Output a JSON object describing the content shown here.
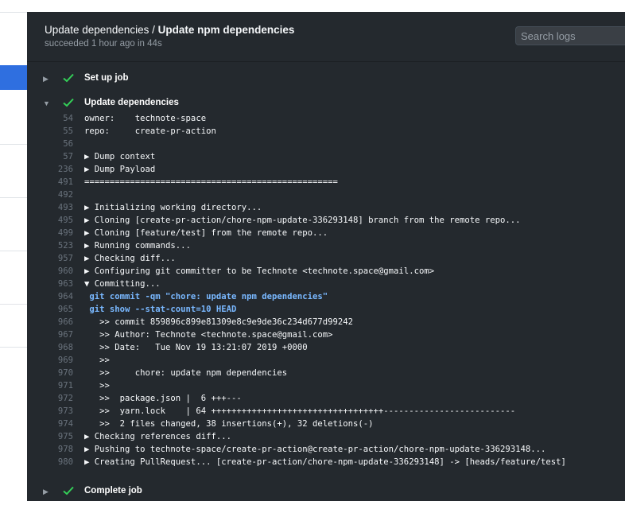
{
  "header": {
    "title_prefix": "Update dependencies / ",
    "title_bold": "Update npm dependencies",
    "subtitle": "succeeded 1 hour ago in 44s"
  },
  "search": {
    "placeholder": "Search logs"
  },
  "steps": {
    "setup": {
      "label": "Set up job",
      "status": "success"
    },
    "update": {
      "label": "Update dependencies",
      "status": "success",
      "expanded": true
    },
    "complete": {
      "label": "Complete job",
      "status": "success"
    }
  },
  "colors": {
    "success": "#34d058",
    "command": "#79b8ff",
    "panel_bg": "#24292e",
    "selected_nav": "#2f6fe0"
  },
  "log_lines": [
    {
      "num": "54",
      "text": "owner:    technote-space"
    },
    {
      "num": "55",
      "text": "repo:     create-pr-action"
    },
    {
      "num": "56",
      "text": ""
    },
    {
      "num": "57",
      "text": "▶ Dump context"
    },
    {
      "num": "236",
      "text": "▶ Dump Payload"
    },
    {
      "num": "491",
      "text": "=================================================="
    },
    {
      "num": "492",
      "text": ""
    },
    {
      "num": "493",
      "text": "▶ Initializing working directory..."
    },
    {
      "num": "495",
      "text": "▶ Cloning [create-pr-action/chore-npm-update-336293148] branch from the remote repo..."
    },
    {
      "num": "499",
      "text": "▶ Cloning [feature/test] from the remote repo..."
    },
    {
      "num": "523",
      "text": "▶ Running commands..."
    },
    {
      "num": "957",
      "text": "▶ Checking diff..."
    },
    {
      "num": "960",
      "text": "▶ Configuring git committer to be Technote <technote.space@gmail.com>"
    },
    {
      "num": "963",
      "text": "▼ Committing..."
    },
    {
      "num": "964",
      "text": " git commit -qm \"chore: update npm dependencies\"",
      "cmd": true
    },
    {
      "num": "965",
      "text": " git show --stat-count=10 HEAD",
      "cmd": true
    },
    {
      "num": "966",
      "text": "   >> commit 859896c899e81309e8c9e9de36c234d677d99242"
    },
    {
      "num": "967",
      "text": "   >> Author: Technote <technote.space@gmail.com>"
    },
    {
      "num": "968",
      "text": "   >> Date:   Tue Nov 19 13:21:07 2019 +0000"
    },
    {
      "num": "969",
      "text": "   >>"
    },
    {
      "num": "970",
      "text": "   >>     chore: update npm dependencies"
    },
    {
      "num": "971",
      "text": "   >>"
    },
    {
      "num": "972",
      "text": "   >>  package.json |  6 +++---"
    },
    {
      "num": "973",
      "text": "   >>  yarn.lock    | 64 ++++++++++++++++++++++++++++++++++--------------------------"
    },
    {
      "num": "974",
      "text": "   >>  2 files changed, 38 insertions(+), 32 deletions(-)"
    },
    {
      "num": "975",
      "text": "▶ Checking references diff..."
    },
    {
      "num": "978",
      "text": "▶ Pushing to technote-space/create-pr-action@create-pr-action/chore-npm-update-336293148..."
    },
    {
      "num": "980",
      "text": "▶ Creating PullRequest... [create-pr-action/chore-npm-update-336293148] -> [heads/feature/test]"
    }
  ]
}
